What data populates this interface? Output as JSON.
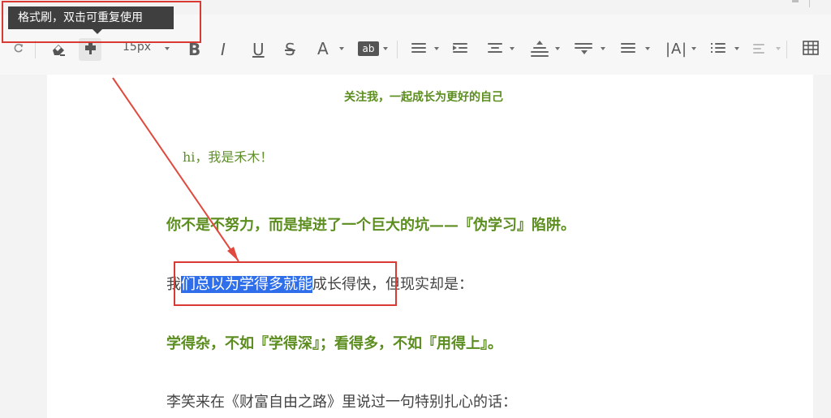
{
  "tooltip": {
    "text": "格式刷，双击可重复使用"
  },
  "toolbar": {
    "font_size": "15px",
    "bold": "B",
    "italic": "I",
    "underline": "U",
    "strike": "S",
    "font_color": "A",
    "highlight": "ab"
  },
  "document": {
    "header_text": "关注我，一起成长为更好的自己",
    "greeting": "hi，我是禾木！",
    "line1": "你不是不努力，而是掉进了一个巨大的坑——『伪学习』陷阱。",
    "line2_prefix": "我",
    "line2_selected": "们总以为学得多就能",
    "line2_suffix": "成长得快，但现实却是：",
    "line3": "学得杂，不如『学得深』；看得多，不如『用得上』。",
    "line4": "李笑来在《财富自由之路》里说过一句特别扎心的话："
  },
  "icons": {
    "undo": "undo-icon",
    "clear_format": "eraser-icon",
    "format_painter": "format-painter-icon",
    "align_left": "align-left-icon",
    "indent": "indent-icon",
    "align_center": "align-center-icon",
    "line_height": "line-height-icon",
    "paragraph_spacing": "paragraph-spacing-icon",
    "list": "list-icon",
    "letter_spacing": "letter-spacing-icon",
    "bulleted_list": "bulleted-list-icon",
    "more": "more-icon",
    "table": "table-icon"
  }
}
